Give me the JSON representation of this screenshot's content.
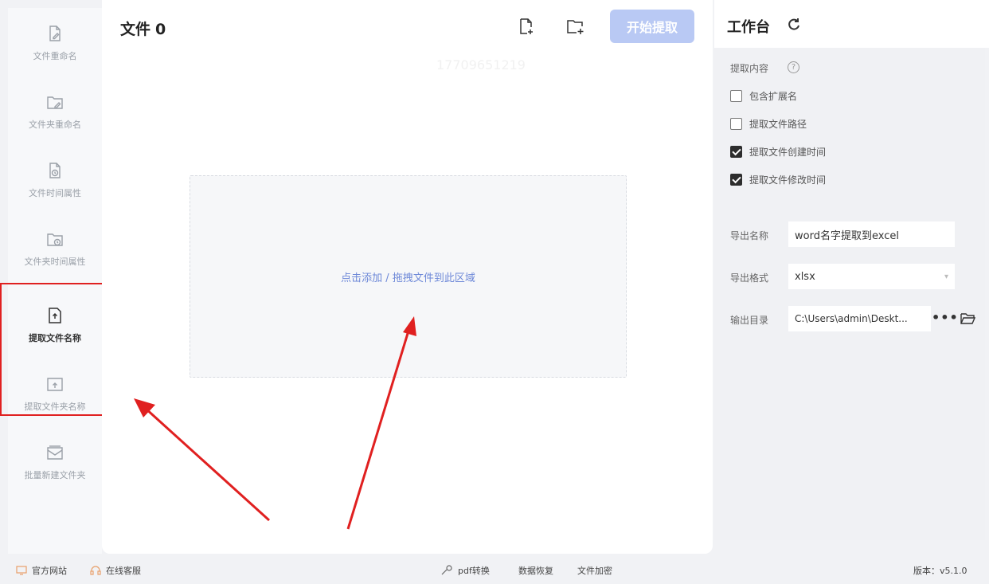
{
  "sidebar": {
    "items": [
      {
        "label": "文件重命名",
        "icon": "file-edit-icon"
      },
      {
        "label": "文件夹重命名",
        "icon": "folder-edit-icon"
      },
      {
        "label": "文件时间属性",
        "icon": "file-clock-icon"
      },
      {
        "label": "文件夹时间属性",
        "icon": "folder-clock-icon"
      },
      {
        "label": "提取文件名称",
        "icon": "file-upload-icon"
      },
      {
        "label": "提取文件夹名称",
        "icon": "folder-upload-icon"
      },
      {
        "label": "批量新建文件夹",
        "icon": "folder-batch-icon"
      }
    ],
    "active_index": 4
  },
  "main": {
    "title": "文件",
    "count": "0",
    "start_button": "开始提取",
    "dropzone_text": "点击添加 / 拖拽文件到此区域",
    "watermark": "17709651219"
  },
  "right": {
    "title": "工作台",
    "extract_label": "提取内容",
    "options": [
      {
        "label": "包含扩展名",
        "checked": false
      },
      {
        "label": "提取文件路径",
        "checked": false
      },
      {
        "label": "提取文件创建时间",
        "checked": true
      },
      {
        "label": "提取文件修改时间",
        "checked": true
      }
    ],
    "export_name_label": "导出名称",
    "export_name_value": "word名字提取到excel",
    "export_format_label": "导出格式",
    "export_format_value": "xlsx",
    "output_dir_label": "输出目录",
    "output_dir_value": "C:\\Users\\admin\\Deskt...",
    "browse_dots": "•••"
  },
  "statusbar": {
    "website": "官方网站",
    "support": "在线客服",
    "pdf": "pdf转换",
    "recovery": "数据恢复",
    "encrypt": "文件加密",
    "version": "版本：v5.1.0"
  },
  "colors": {
    "accent": "#6d88d8",
    "start_button": "#b9c9f4",
    "highlight": "#e02020"
  }
}
